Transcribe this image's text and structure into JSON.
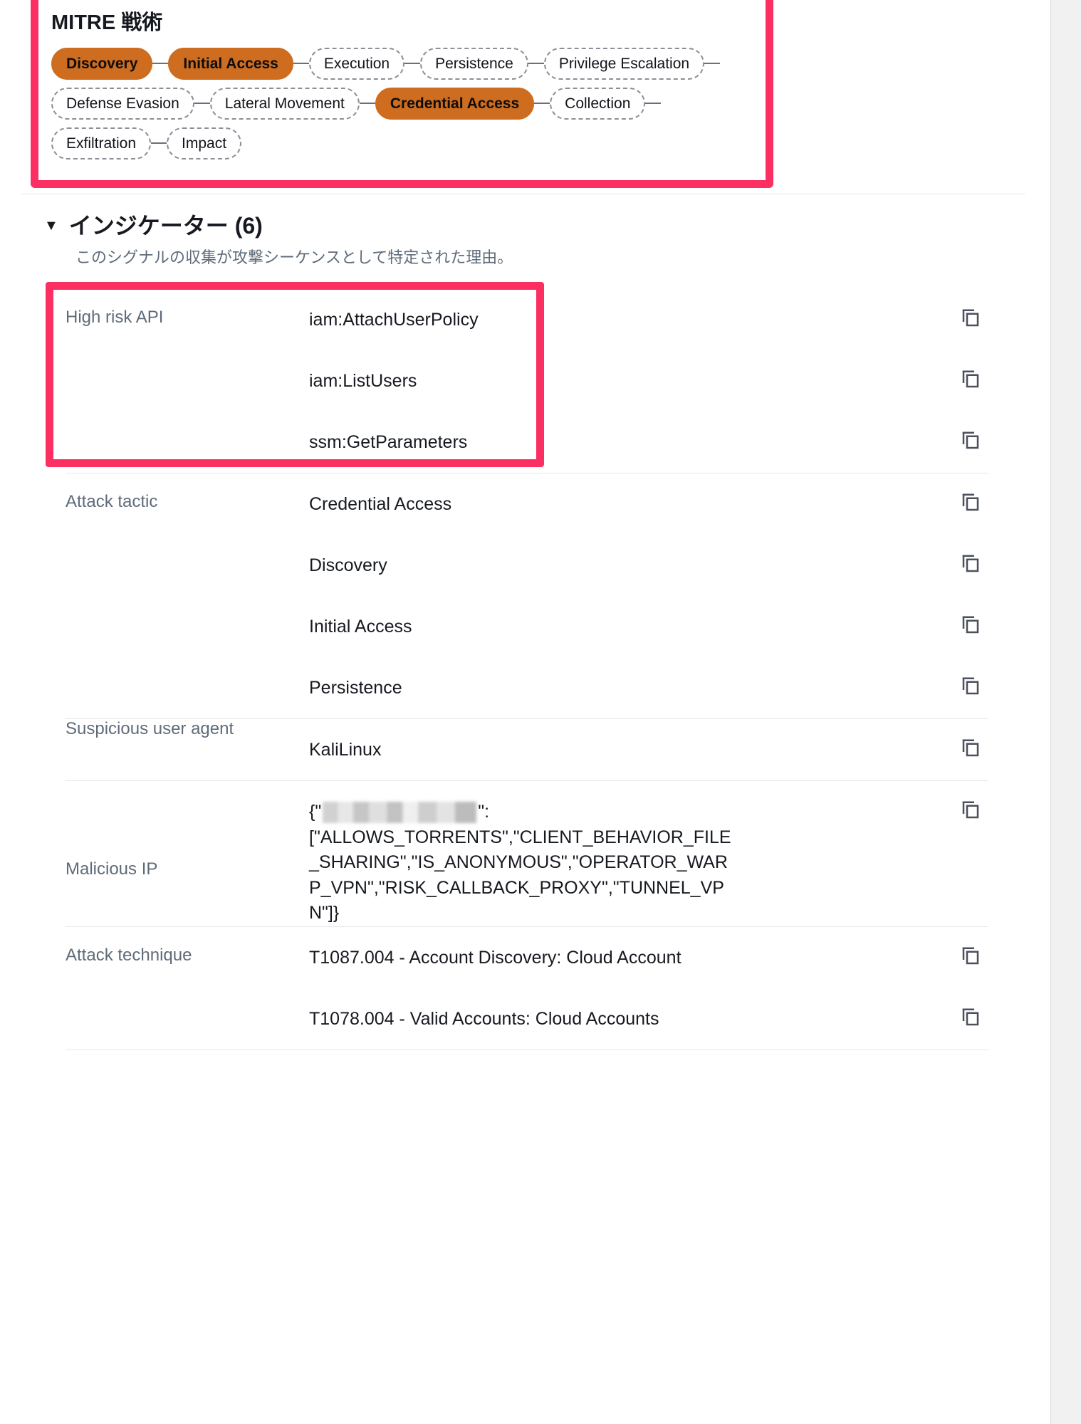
{
  "mitre": {
    "title": "MITRE 戦術",
    "rows": [
      [
        {
          "label": "Discovery",
          "active": true
        },
        {
          "label": "Initial Access",
          "active": true
        },
        {
          "label": "Execution",
          "active": false
        },
        {
          "label": "Persistence",
          "active": false
        },
        {
          "label": "Privilege Escalation",
          "active": false
        }
      ],
      [
        {
          "label": "Defense Evasion",
          "active": false
        },
        {
          "label": "Lateral Movement",
          "active": false
        },
        {
          "label": "Credential Access",
          "active": true
        },
        {
          "label": "Collection",
          "active": false
        }
      ],
      [
        {
          "label": "Exfiltration",
          "active": false
        },
        {
          "label": "Impact",
          "active": false
        }
      ]
    ],
    "active_color": "#ce6c1f",
    "highlight_color": "#fb2f61"
  },
  "indicators": {
    "caret": "▼",
    "title": "インジケーター (6)",
    "subtitle": "このシグナルの収集が攻撃シーケンスとして特定された理由。",
    "copy_icon": "copy-icon",
    "groups": [
      {
        "label": "High risk API",
        "highlighted": true,
        "values": [
          "iam:AttachUserPolicy",
          "iam:ListUsers",
          "ssm:GetParameters"
        ]
      },
      {
        "label": "Attack tactic",
        "highlighted": false,
        "values": [
          "Credential Access",
          "Discovery",
          "Initial Access",
          "Persistence"
        ]
      },
      {
        "label": "Suspicious user agent",
        "highlighted": false,
        "values": [
          "KaliLinux"
        ]
      },
      {
        "label": "Malicious IP",
        "highlighted": false,
        "redacted": true,
        "value_prefix": "{\"",
        "value_suffix": "\":[\"ALLOWS_TORRENTS\",\"CLIENT_BEHAVIOR_FILE_SHARING\",\"IS_ANONYMOUS\",\"OPERATOR_WARP_VPN\",\"RISK_CALLBACK_PROXY\",\"TUNNEL_VPN\"]}",
        "values": []
      },
      {
        "label": "Attack technique",
        "highlighted": false,
        "values": [
          "T1087.004 - Account Discovery: Cloud Account",
          "T1078.004 - Valid Accounts: Cloud Accounts"
        ]
      }
    ]
  }
}
